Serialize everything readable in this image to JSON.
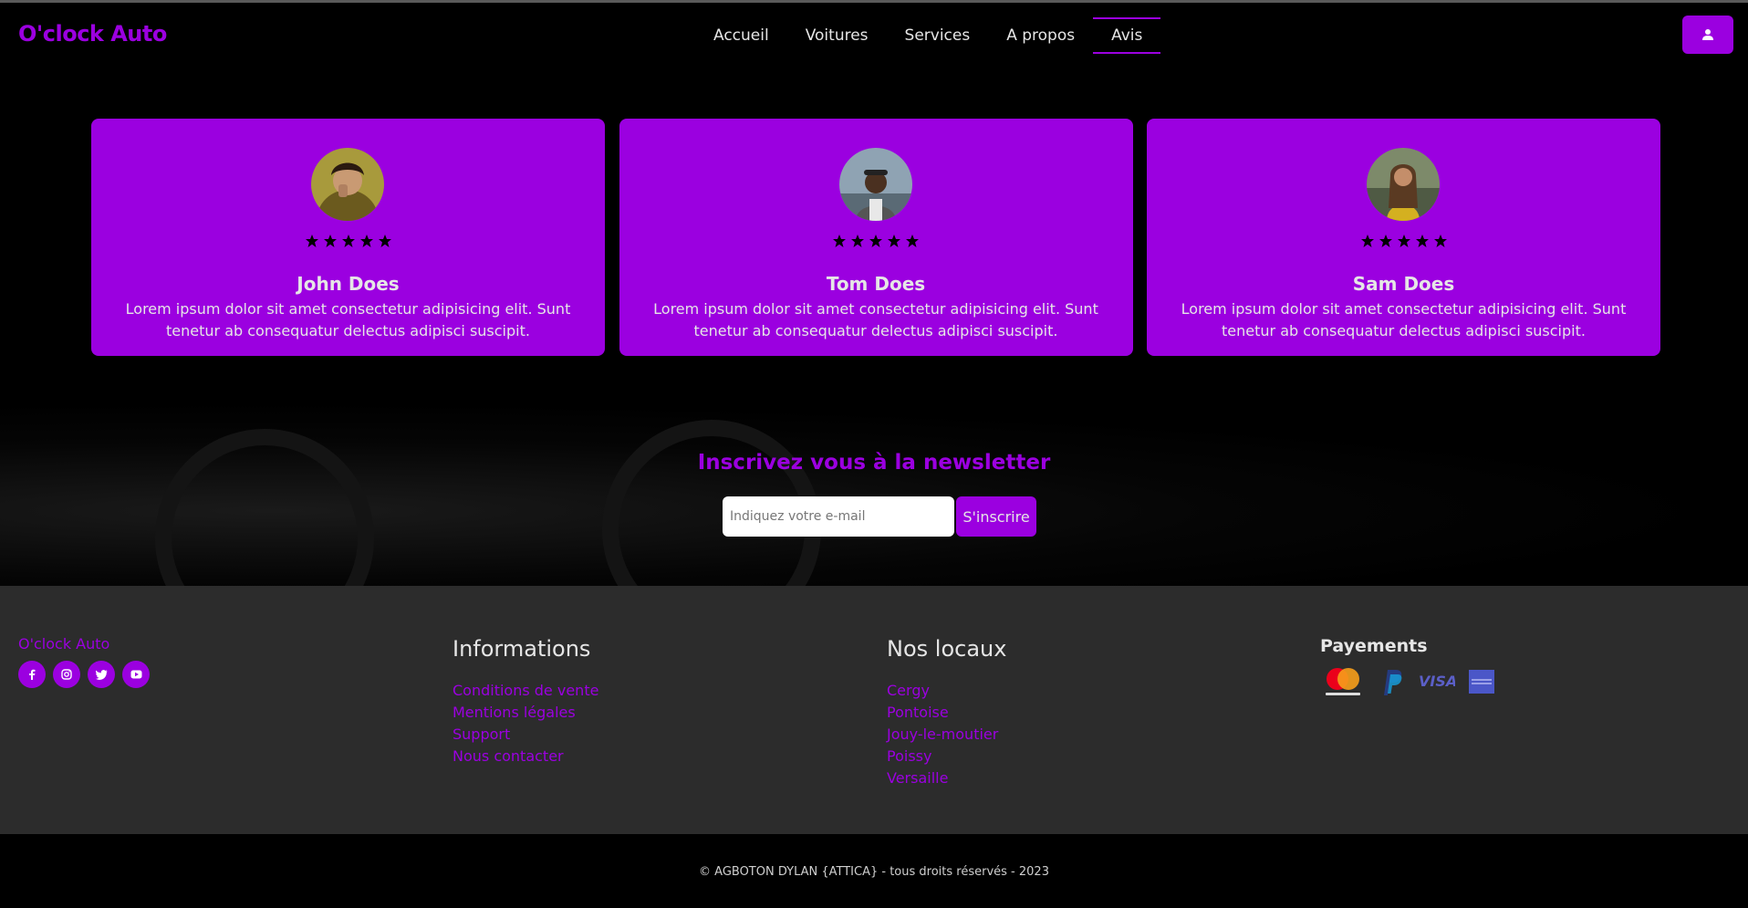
{
  "header": {
    "brand": "O'clock Auto",
    "nav": [
      {
        "label": "Accueil"
      },
      {
        "label": "Voitures"
      },
      {
        "label": "Services"
      },
      {
        "label": "A propos"
      },
      {
        "label": "Avis"
      }
    ],
    "user_icon": "user-icon"
  },
  "reviews": [
    {
      "name": "John Does",
      "text": "Lorem ipsum dolor sit amet consectetur adipisicing elit. Sunt tenetur ab consequatur delectus adipisci suscipit.",
      "rating": 5
    },
    {
      "name": "Tom Does",
      "text": "Lorem ipsum dolor sit amet consectetur adipisicing elit. Sunt tenetur ab consequatur delectus adipisci suscipit.",
      "rating": 5
    },
    {
      "name": "Sam Does",
      "text": "Lorem ipsum dolor sit amet consectetur adipisicing elit. Sunt tenetur ab consequatur delectus adipisci suscipit.",
      "rating": 5
    }
  ],
  "newsletter": {
    "title": "Inscrivez vous à la newsletter",
    "placeholder": "Indiquez votre e-mail",
    "button": "S'inscrire"
  },
  "footer": {
    "brand": "O'clock Auto",
    "socials": [
      "facebook-icon",
      "instagram-icon",
      "twitter-icon",
      "youtube-icon"
    ],
    "informations": {
      "title": "Informations",
      "links": [
        "Conditions de vente",
        "Mentions légales",
        "Support",
        "Nous contacter"
      ]
    },
    "locaux": {
      "title": "Nos locaux",
      "links": [
        "Cergy",
        "Pontoise",
        "Jouy-le-moutier",
        "Poissy",
        "Versaille"
      ]
    },
    "payments": {
      "title": "Payements",
      "icons": [
        "mastercard-icon",
        "paypal-icon",
        "visa-icon",
        "amex-icon"
      ]
    },
    "copyright": "© AGBOTON DYLAN {ATTICA} - tous droits réservés - 2023"
  },
  "colors": {
    "accent": "#9b00e0",
    "footer_bg": "#2c2c2c",
    "page_bg": "#000000"
  }
}
